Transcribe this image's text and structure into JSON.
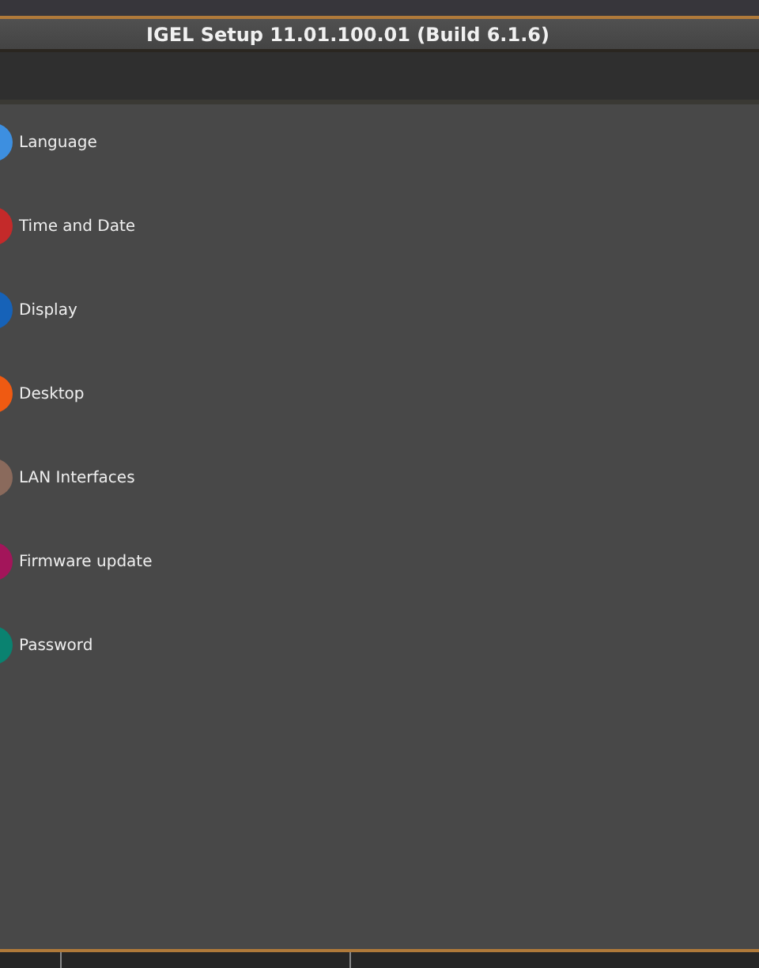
{
  "window": {
    "title": "IGEL Setup 11.01.100.01 (Build 6.1.6)"
  },
  "items": [
    {
      "label": "Language",
      "color": "#3d8fe0"
    },
    {
      "label": "Time and Date",
      "color": "#c42a2a"
    },
    {
      "label": "Display",
      "color": "#1662b8"
    },
    {
      "label": "Desktop",
      "color": "#ef5a12"
    },
    {
      "label": "LAN Interfaces",
      "color": "#8a6a5c"
    },
    {
      "label": "Firmware update",
      "color": "#a3155a"
    },
    {
      "label": "Password",
      "color": "#0a8270"
    }
  ]
}
